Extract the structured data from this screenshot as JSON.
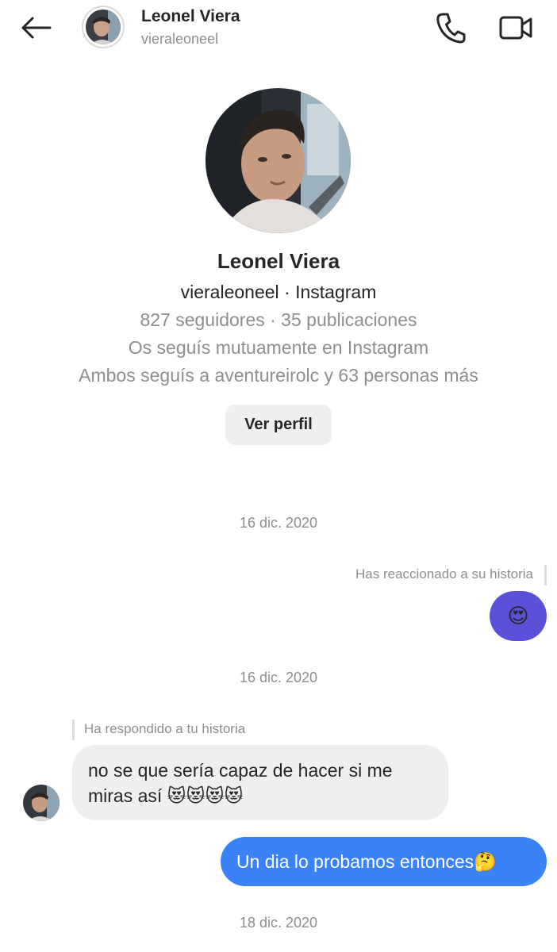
{
  "header": {
    "name": "Leonel Viera",
    "username": "vieraleoneel",
    "icons": {
      "back": "back-arrow-icon",
      "call": "phone-icon",
      "video": "video-camera-icon"
    }
  },
  "profile": {
    "name": "Leonel Viera",
    "user_line": "vieraleoneel · Instagram",
    "stats": "827 seguidores · 35 publicaciones",
    "mutual": "Os seguís mutuamente en Instagram",
    "both_follow": "Ambos seguís a aventureirolc y 63 personas más",
    "view_profile_label": "Ver perfil"
  },
  "messages": {
    "date_1": "16 dic. 2020",
    "reaction_label": "Has reaccionado a su historia",
    "reaction_emoji": "😍",
    "date_2": "16 dic. 2020",
    "reply_label": "Ha respondido a tu historia",
    "received_text": "no se que sería capaz de hacer si me miras así 😻😻😻😻",
    "sent_text": "Un dia lo probamos entonces🤔",
    "date_3": "18 dic. 2020"
  },
  "colors": {
    "reaction_bubble": "#5b51d8",
    "sent_bubble": "#3b82f6",
    "received_bubble": "#efefef",
    "secondary_text": "#8e8e8e"
  }
}
